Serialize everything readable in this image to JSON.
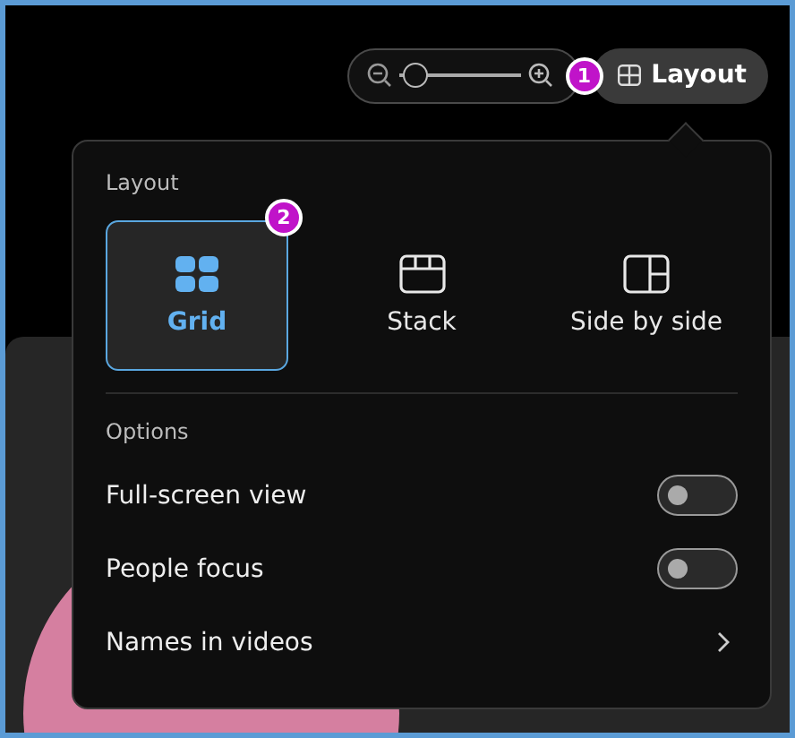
{
  "toolbar": {
    "zoom": {
      "level": 0.05
    },
    "step_badge": "1",
    "layout_button": {
      "label": "Layout"
    }
  },
  "layout_menu": {
    "section_title": "Layout",
    "step_badge": "2",
    "options": [
      {
        "label": "Grid",
        "kind": "grid",
        "selected": true
      },
      {
        "label": "Stack",
        "kind": "stack",
        "selected": false
      },
      {
        "label": "Side by side",
        "kind": "side",
        "selected": false
      }
    ],
    "options_title": "Options",
    "settings": [
      {
        "label": "Full-screen view",
        "kind": "toggle",
        "on": false
      },
      {
        "label": "People focus",
        "kind": "toggle",
        "on": false
      },
      {
        "label": "Names in videos",
        "kind": "submenu"
      }
    ]
  }
}
